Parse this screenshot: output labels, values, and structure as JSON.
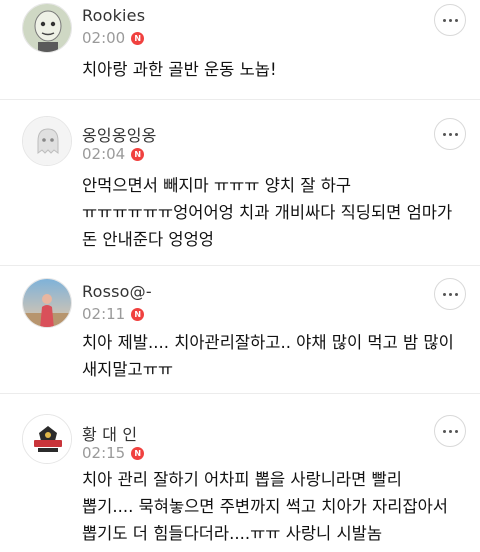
{
  "comments": [
    {
      "author": "Rookies",
      "time": "02:00",
      "badge": "N",
      "avatar_icon": "cartoon-face-avatar",
      "lines": [
        "치아랑 과한 골반 운동 노놉!"
      ]
    },
    {
      "author": "옹잉옹잉옹",
      "time": "02:04",
      "badge": "N",
      "avatar_icon": "default-ghost-avatar",
      "lines": [
        "안먹으면서 빼지마 ㅠㅠㅠ 양치 잘 하구",
        "ㅠㅠㅠㅠㅠㅠ엉어어엉 치과 개비싸다 직딩되면 엄마가",
        "돈 안내준다 엉엉엉"
      ]
    },
    {
      "author": "Rosso@-",
      "time": "02:11",
      "badge": "N",
      "avatar_icon": "photo-avatar",
      "lines": [
        "치아 제발.... 치아관리잘하고.. 야채 많이 먹고 밤 많이",
        "새지말고ㅠㅠ"
      ]
    },
    {
      "author": "황 대 인",
      "time": "02:15",
      "badge": "N",
      "avatar_icon": "team-logo-avatar",
      "lines": [
        "치아 관리 잘하기 어차피 뽑을 사랑니라면 빨리",
        "뽑기.... 묵혀놓으면 주변까지 썩고 치아가 자리잡아서",
        "뽑기도 더 힘들다더라....ㅠㅠ 사랑니 시발놈"
      ]
    }
  ],
  "colors": {
    "badge": "#f0413f",
    "time": "#9a9a9a",
    "divider": "#ececec"
  }
}
